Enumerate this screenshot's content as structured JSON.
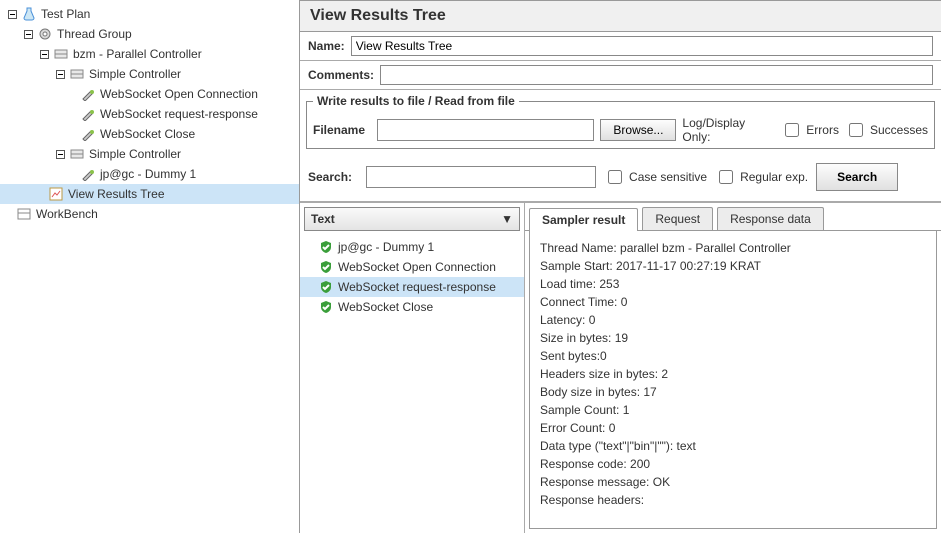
{
  "tree": {
    "test_plan": "Test Plan",
    "thread_group": "Thread Group",
    "parallel": "bzm - Parallel Controller",
    "simple1": "Simple Controller",
    "ws_open": "WebSocket Open Connection",
    "ws_reqresp": "WebSocket request-response",
    "ws_close": "WebSocket Close",
    "simple2": "Simple Controller",
    "dummy1": "jp@gc - Dummy 1",
    "view_results": "View Results Tree",
    "workbench": "WorkBench"
  },
  "panel": {
    "title": "View Results Tree",
    "name_label": "Name:",
    "name_value": "View Results Tree",
    "comments_label": "Comments:",
    "write_legend": "Write results to file / Read from file",
    "filename_label": "Filename",
    "filename_value": "",
    "browse_btn": "Browse...",
    "log_display": "Log/Display Only:",
    "errors_chk": "Errors",
    "successes_chk": "Successes"
  },
  "search": {
    "label": "Search:",
    "value": "",
    "case_sensitive": "Case sensitive",
    "regular_exp": "Regular exp.",
    "search_btn": "Search"
  },
  "results": {
    "combo": "Text",
    "items": [
      "jp@gc - Dummy 1",
      "WebSocket Open Connection",
      "WebSocket request-response",
      "WebSocket Close"
    ]
  },
  "tabs": {
    "sampler": "Sampler result",
    "request": "Request",
    "response": "Response data"
  },
  "detail": {
    "l0": "Thread Name: parallel bzm - Parallel Controller",
    "l1": "Sample Start: 2017-11-17 00:27:19 KRAT",
    "l2": "Load time: 253",
    "l3": "Connect Time: 0",
    "l4": "Latency: 0",
    "l5": "Size in bytes: 19",
    "l6": "Sent bytes:0",
    "l7": "Headers size in bytes: 2",
    "l8": "Body size in bytes: 17",
    "l9": "Sample Count: 1",
    "l10": "Error Count: 0",
    "l11": "Data type (\"text\"|\"bin\"|\"\"): text",
    "l12": "Response code: 200",
    "l13": "Response message: OK",
    "l14": "",
    "l15": "Response headers:"
  }
}
